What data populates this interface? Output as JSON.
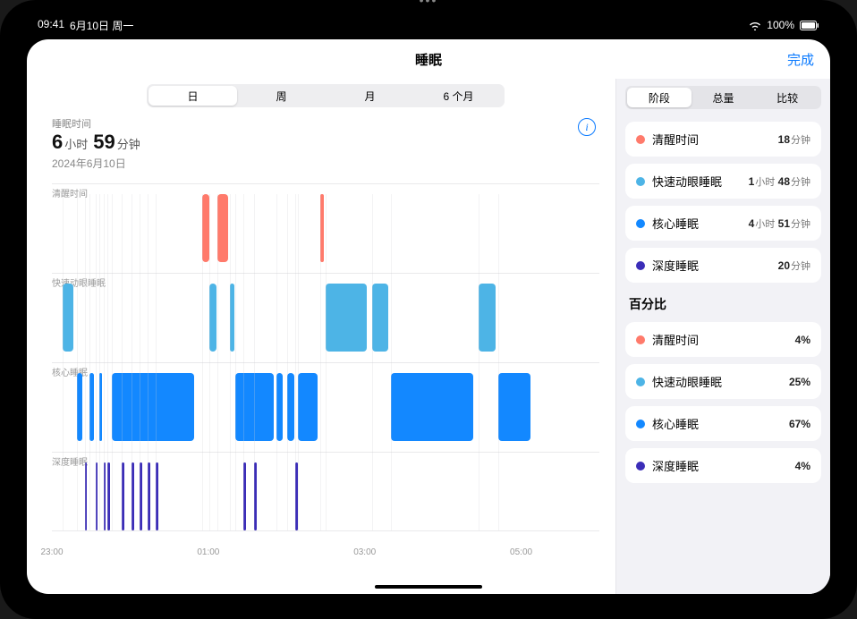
{
  "status": {
    "time": "09:41",
    "date": "6月10日 周一",
    "battery": "100%"
  },
  "header": {
    "title": "睡眠",
    "done": "完成"
  },
  "period_tabs": {
    "day": "日",
    "week": "周",
    "month": "月",
    "six_month": "6 个月"
  },
  "summary": {
    "label": "睡眠时间",
    "hours": "6",
    "hours_unit": "小时",
    "minutes": "59",
    "minutes_unit": "分钟",
    "date": "2024年6月10日"
  },
  "stage_labels": {
    "awake": "清醒时间",
    "rem": "快速动眼睡眠",
    "core": "核心睡眠",
    "deep": "深度睡眠"
  },
  "x_ticks": [
    "23:00",
    "01:00",
    "03:00",
    "05:00"
  ],
  "sidebar_tabs": {
    "stage": "阶段",
    "total": "总量",
    "compare": "比较"
  },
  "durations": {
    "awake": {
      "num": "18",
      "unit": "分钟"
    },
    "rem": {
      "h": "1",
      "hu": "小时",
      "m": "48",
      "mu": "分钟"
    },
    "core": {
      "h": "4",
      "hu": "小时",
      "m": "51",
      "mu": "分钟"
    },
    "deep": {
      "num": "20",
      "unit": "分钟"
    }
  },
  "percent_title": "百分比",
  "percents": {
    "awake": "4%",
    "rem": "25%",
    "core": "67%",
    "deep": "4%"
  },
  "colors": {
    "awake": "#ff7a6b",
    "rem": "#4db4e6",
    "core": "#1388ff",
    "deep": "#3b2db8"
  },
  "chart_data": {
    "type": "bar",
    "xlabel": "",
    "ylabel": "",
    "x_range_hours": [
      23,
      30
    ],
    "stages": [
      "清醒时间",
      "快速动眼睡眠",
      "核心睡眠",
      "深度睡眠"
    ],
    "rows": {
      "awake": {
        "top_pct": 0,
        "height_pct": 22
      },
      "rem": {
        "top_pct": 25,
        "height_pct": 22
      },
      "core": {
        "top_pct": 50,
        "height_pct": 22
      },
      "deep": {
        "top_pct": 75,
        "height_pct": 22
      }
    },
    "segments": [
      {
        "stage": "rem",
        "left_pct": 2.0,
        "width_pct": 2.0
      },
      {
        "stage": "core",
        "left_pct": 4.5,
        "width_pct": 1.0
      },
      {
        "stage": "deep",
        "left_pct": 6.0,
        "width_pct": 0.4
      },
      {
        "stage": "core",
        "left_pct": 6.8,
        "width_pct": 0.8
      },
      {
        "stage": "deep",
        "left_pct": 8.0,
        "width_pct": 0.4
      },
      {
        "stage": "core",
        "left_pct": 8.6,
        "width_pct": 0.6
      },
      {
        "stage": "deep",
        "left_pct": 9.4,
        "width_pct": 0.4
      },
      {
        "stage": "deep",
        "left_pct": 10.2,
        "width_pct": 0.4
      },
      {
        "stage": "core",
        "left_pct": 11.0,
        "width_pct": 15.0
      },
      {
        "stage": "deep",
        "left_pct": 12.8,
        "width_pct": 0.5
      },
      {
        "stage": "deep",
        "left_pct": 14.5,
        "width_pct": 0.5
      },
      {
        "stage": "deep",
        "left_pct": 16.0,
        "width_pct": 0.5
      },
      {
        "stage": "deep",
        "left_pct": 17.5,
        "width_pct": 0.5
      },
      {
        "stage": "deep",
        "left_pct": 19.0,
        "width_pct": 0.5
      },
      {
        "stage": "awake",
        "left_pct": 27.5,
        "width_pct": 1.2
      },
      {
        "stage": "rem",
        "left_pct": 28.8,
        "width_pct": 1.2
      },
      {
        "stage": "awake",
        "left_pct": 30.2,
        "width_pct": 2.0
      },
      {
        "stage": "rem",
        "left_pct": 32.5,
        "width_pct": 0.8
      },
      {
        "stage": "core",
        "left_pct": 33.5,
        "width_pct": 7.0
      },
      {
        "stage": "deep",
        "left_pct": 35.0,
        "width_pct": 0.5
      },
      {
        "stage": "deep",
        "left_pct": 37.0,
        "width_pct": 0.5
      },
      {
        "stage": "core",
        "left_pct": 41.0,
        "width_pct": 1.2
      },
      {
        "stage": "core",
        "left_pct": 43.0,
        "width_pct": 1.2
      },
      {
        "stage": "deep",
        "left_pct": 44.5,
        "width_pct": 0.5
      },
      {
        "stage": "core",
        "left_pct": 45.0,
        "width_pct": 3.5
      },
      {
        "stage": "awake",
        "left_pct": 49.0,
        "width_pct": 0.6
      },
      {
        "stage": "rem",
        "left_pct": 50.0,
        "width_pct": 7.5
      },
      {
        "stage": "rem",
        "left_pct": 58.5,
        "width_pct": 3.0
      },
      {
        "stage": "core",
        "left_pct": 62.0,
        "width_pct": 15.0
      },
      {
        "stage": "rem",
        "left_pct": 78.0,
        "width_pct": 3.0
      },
      {
        "stage": "core",
        "left_pct": 81.5,
        "width_pct": 6.0
      }
    ]
  }
}
